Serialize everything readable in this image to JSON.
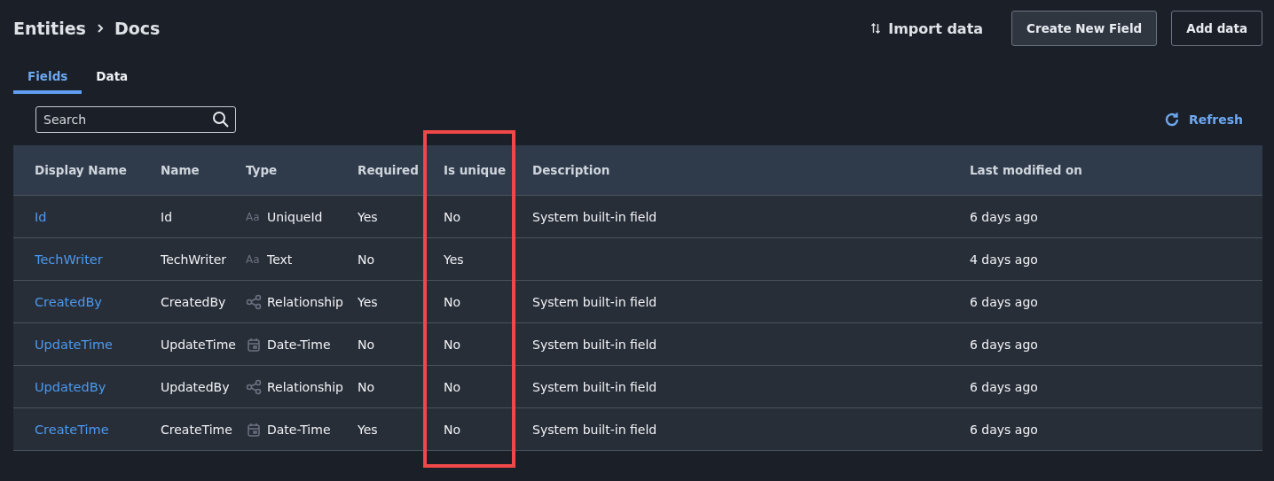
{
  "breadcrumb": [
    "Entities",
    "Docs"
  ],
  "actions": {
    "import": "Import data",
    "buttons": [
      {
        "label": "Create New Field",
        "kind": "secondary"
      },
      {
        "label": "Add data",
        "kind": "outline"
      }
    ]
  },
  "tabs": [
    {
      "label": "Fields",
      "selected": true
    },
    {
      "label": "Data",
      "selected": false
    }
  ],
  "search": {
    "placeholder": "Search"
  },
  "refresh": "Refresh",
  "table": {
    "columns": [
      {
        "label": "Display Name",
        "highlighted": false
      },
      {
        "label": "Name",
        "highlighted": false
      },
      {
        "label": "Type",
        "highlighted": false
      },
      {
        "label": "Required",
        "highlighted": false
      },
      {
        "label": "Is unique",
        "highlighted": true
      },
      {
        "label": "Description",
        "highlighted": false
      },
      {
        "label": "Last modified on",
        "highlighted": false
      }
    ],
    "rows": [
      {
        "display_name": "Id",
        "name": "Id",
        "kind": "text",
        "type_icon": "Aa",
        "type": "UniqueId",
        "required": "Yes",
        "unique": "No",
        "description": "System built-in field",
        "modified": "6 days ago"
      },
      {
        "display_name": "TechWriter",
        "name": "TechWriter",
        "kind": "text",
        "type_icon": "Aa",
        "type": "Text",
        "required": "No",
        "unique": "Yes",
        "modified": "4 days ago"
      },
      {
        "display_name": "CreatedBy",
        "name": "CreatedBy",
        "kind": "relationship",
        "type": "Relationship",
        "required": "Yes",
        "unique": "No",
        "description": "System built-in field",
        "modified": "6 days ago"
      },
      {
        "display_name": "UpdateTime",
        "name": "UpdateTime",
        "kind": "datetime",
        "type": "Date-Time",
        "required": "No",
        "unique": "No",
        "description": "System built-in field",
        "modified": "6 days ago"
      },
      {
        "display_name": "UpdatedBy",
        "name": "UpdatedBy",
        "kind": "relationship",
        "type": "Relationship",
        "required": "No",
        "unique": "No",
        "description": "System built-in field",
        "modified": "6 days ago"
      },
      {
        "display_name": "CreateTime",
        "name": "CreateTime",
        "kind": "datetime",
        "type": "Date-Time",
        "required": "Yes",
        "unique": "No",
        "description": "System built-in field",
        "modified": "6 days ago"
      }
    ]
  }
}
